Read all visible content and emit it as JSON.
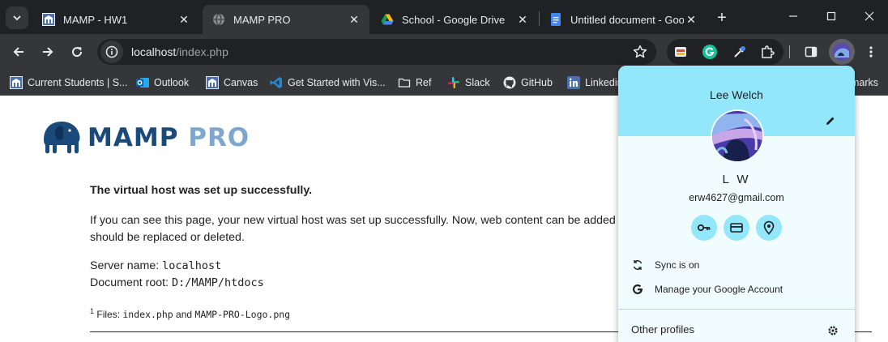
{
  "tabs": [
    {
      "title": "MAMP - HW1",
      "icon": "mamp-favicon"
    },
    {
      "title": "MAMP PRO",
      "icon": "globe-favicon",
      "active": true
    },
    {
      "title": "School - Google Drive",
      "icon": "google-drive-favicon"
    },
    {
      "title": "Untitled document - Goo",
      "icon": "google-docs-favicon"
    }
  ],
  "omnibox": {
    "host": "localhost",
    "path": "/index.php"
  },
  "bookmarks": [
    {
      "label": "Current Students | S...",
      "icon": "university-icon"
    },
    {
      "label": "Outlook",
      "icon": "outlook-icon"
    },
    {
      "label": "Canvas",
      "icon": "university-icon"
    },
    {
      "label": "Get Started with Vis...",
      "icon": "vscode-icon"
    },
    {
      "label": "Ref",
      "icon": "folder-icon"
    },
    {
      "label": "Slack",
      "icon": "slack-icon"
    },
    {
      "label": "GitHub",
      "icon": "github-icon"
    },
    {
      "label": "Linkedin",
      "icon": "linkedin-icon"
    },
    {
      "label": "marks",
      "icon": "folder-icon"
    }
  ],
  "page": {
    "logo_part1": "MAMP",
    "logo_part2": "PRO",
    "heading": "The virtual host was set up successfully.",
    "intro_line1": "If you can see this page, your new virtual host was set up successfully. Now, web content can be added",
    "intro_line2": "should be replaced or deleted.",
    "server_name_label": "Server name:",
    "server_name_value": "localhost",
    "doc_root_label": "Document root:",
    "doc_root_value": "D:/MAMP/htdocs",
    "footnote_mark": "1",
    "footnote_label": "Files:",
    "footnote_file1": "index.php",
    "footnote_and": "and",
    "footnote_file2": "MAMP-PRO-Logo.png"
  },
  "profile": {
    "display_name": "Lee Welch",
    "initials": "L W",
    "email": "erw4627@gmail.com",
    "sync_label": "Sync is on",
    "manage_label": "Manage your Google Account",
    "other_profiles_label": "Other profiles"
  },
  "colors": {
    "chrome_dark": "#202124",
    "toolbar": "#35363a",
    "profile_accent": "#93e7fb",
    "mamp_dark": "#1a4a7a",
    "mamp_light": "#7ea7cf"
  }
}
